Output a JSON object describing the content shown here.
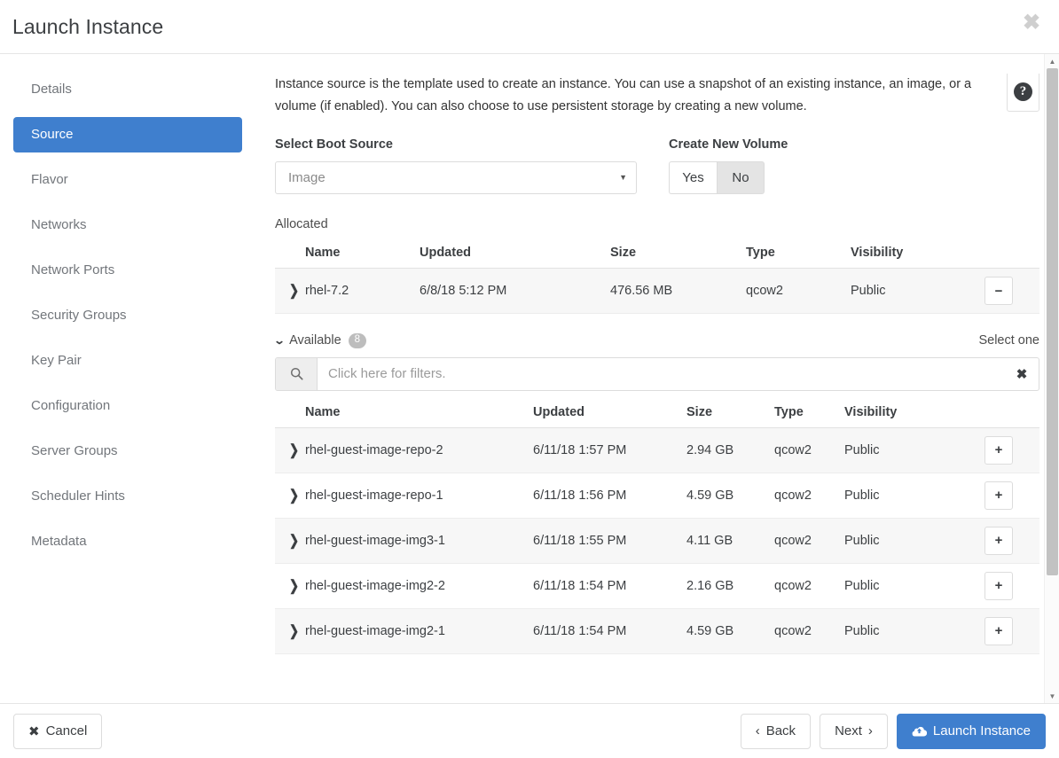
{
  "window": {
    "title": "Launch Instance",
    "close_label": "✖"
  },
  "sidebar": {
    "items": [
      {
        "label": "Details",
        "active": false
      },
      {
        "label": "Source",
        "active": true
      },
      {
        "label": "Flavor",
        "active": false
      },
      {
        "label": "Networks",
        "active": false
      },
      {
        "label": "Network Ports",
        "active": false
      },
      {
        "label": "Security Groups",
        "active": false
      },
      {
        "label": "Key Pair",
        "active": false
      },
      {
        "label": "Configuration",
        "active": false
      },
      {
        "label": "Server Groups",
        "active": false
      },
      {
        "label": "Scheduler Hints",
        "active": false
      },
      {
        "label": "Metadata",
        "active": false
      }
    ]
  },
  "main": {
    "description": "Instance source is the template used to create an instance. You can use a snapshot of an existing instance, an image, or a volume (if enabled). You can also choose to use persistent storage by creating a new volume.",
    "help_icon": "question-mark-icon",
    "boot_source": {
      "label": "Select Boot Source",
      "value": "Image",
      "caret": "▼"
    },
    "create_new_volume": {
      "label": "Create New Volume",
      "yes_label": "Yes",
      "no_label": "No",
      "selected": "No"
    },
    "allocated": {
      "label": "Allocated",
      "columns": [
        "Name",
        "Updated",
        "Size",
        "Type",
        "Visibility"
      ],
      "action_label": "−",
      "rows": [
        {
          "name": "rhel-7.2",
          "updated": "6/8/18 5:12 PM",
          "size": "476.56 MB",
          "type": "qcow2",
          "visibility": "Public"
        }
      ]
    },
    "available": {
      "label": "Available",
      "count": "8",
      "caret": "❯",
      "select_hint": "Select one",
      "filter": {
        "placeholder": "Click here for filters.",
        "value": "",
        "search_icon": "search-icon",
        "clear_label": "✖"
      },
      "columns": [
        "Name",
        "Updated",
        "Size",
        "Type",
        "Visibility"
      ],
      "action_label": "+",
      "rows": [
        {
          "name": "rhel-guest-image-repo-2",
          "updated": "6/11/18 1:57 PM",
          "size": "2.94 GB",
          "type": "qcow2",
          "visibility": "Public"
        },
        {
          "name": "rhel-guest-image-repo-1",
          "updated": "6/11/18 1:56 PM",
          "size": "4.59 GB",
          "type": "qcow2",
          "visibility": "Public"
        },
        {
          "name": "rhel-guest-image-img3-1",
          "updated": "6/11/18 1:55 PM",
          "size": "4.11 GB",
          "type": "qcow2",
          "visibility": "Public"
        },
        {
          "name": "rhel-guest-image-img2-2",
          "updated": "6/11/18 1:54 PM",
          "size": "2.16 GB",
          "type": "qcow2",
          "visibility": "Public"
        },
        {
          "name": "rhel-guest-image-img2-1",
          "updated": "6/11/18 1:54 PM",
          "size": "4.59 GB",
          "type": "qcow2",
          "visibility": "Public"
        }
      ]
    }
  },
  "footer": {
    "cancel_label": "Cancel",
    "cancel_icon": "✖",
    "back_label": "Back",
    "back_icon": "‹",
    "next_label": "Next",
    "next_icon": "›",
    "launch_label": "Launch Instance",
    "launch_icon": "cloud-upload-icon"
  },
  "colors": {
    "accent": "#3f7fce",
    "row_stripe": "#f7f7f7",
    "badge": "#bdbdbd"
  }
}
